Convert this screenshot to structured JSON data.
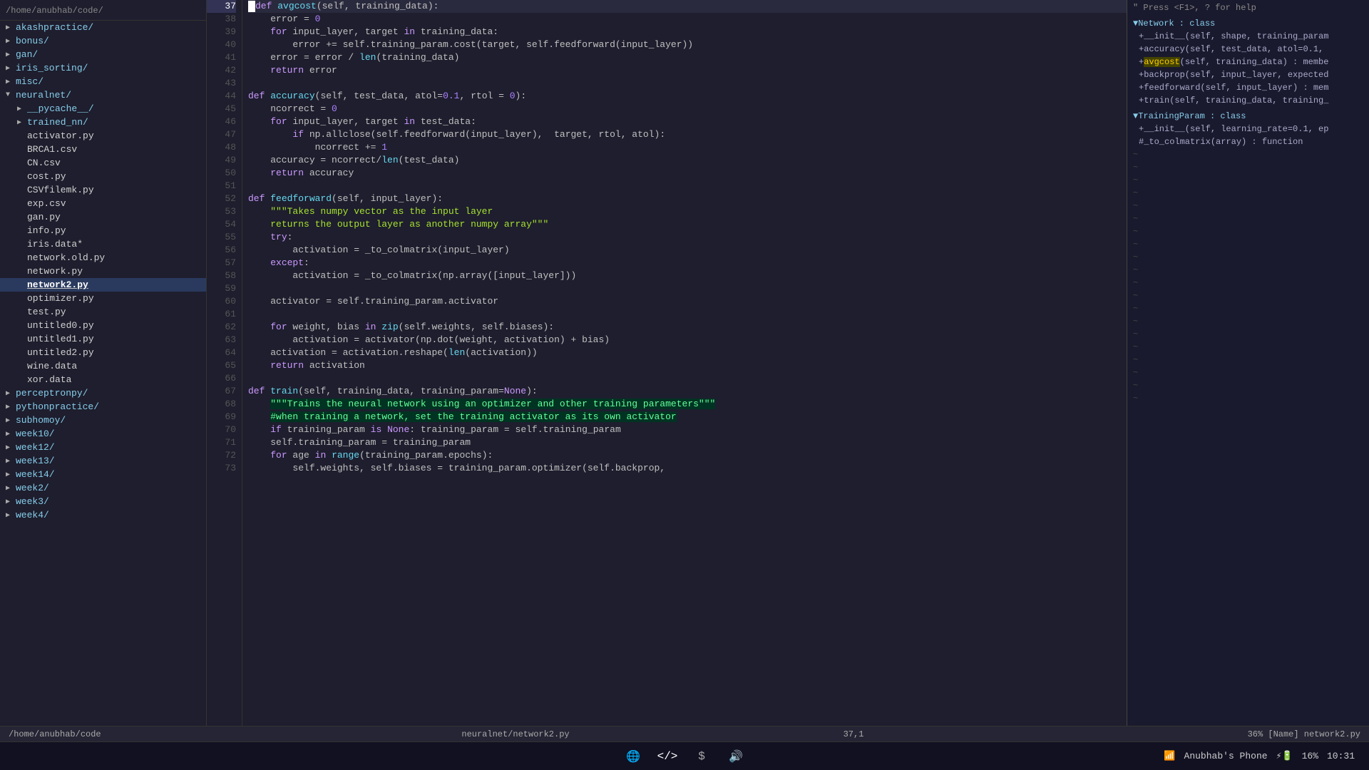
{
  "sidebar": {
    "root_path": "/home/anubhab/code/",
    "items": [
      {
        "id": "akashpractice",
        "label": "akashpractice/",
        "indent": 0,
        "type": "dir",
        "arrow": "▶",
        "expanded": false
      },
      {
        "id": "bonus",
        "label": "bonus/",
        "indent": 0,
        "type": "dir",
        "arrow": "▶",
        "expanded": false
      },
      {
        "id": "gan",
        "label": "gan/",
        "indent": 0,
        "type": "dir",
        "arrow": "▶",
        "expanded": false
      },
      {
        "id": "iris_sorting",
        "label": "iris_sorting/",
        "indent": 0,
        "type": "dir",
        "arrow": "▶",
        "expanded": false
      },
      {
        "id": "misc",
        "label": "misc/",
        "indent": 0,
        "type": "dir",
        "arrow": "▶",
        "expanded": false
      },
      {
        "id": "neuralnet",
        "label": "neuralnet/",
        "indent": 0,
        "type": "dir",
        "arrow": "▼",
        "expanded": true
      },
      {
        "id": "pycache",
        "label": "__pycache__/",
        "indent": 1,
        "type": "dir",
        "arrow": "▶",
        "expanded": false
      },
      {
        "id": "trained_nn",
        "label": "trained_nn/",
        "indent": 1,
        "type": "dir",
        "arrow": "▶",
        "expanded": false
      },
      {
        "id": "activator",
        "label": "activator.py",
        "indent": 1,
        "type": "file",
        "arrow": ""
      },
      {
        "id": "brca1",
        "label": "BRCA1.csv",
        "indent": 1,
        "type": "file",
        "arrow": ""
      },
      {
        "id": "cn",
        "label": "CN.csv",
        "indent": 1,
        "type": "file",
        "arrow": ""
      },
      {
        "id": "cost",
        "label": "cost.py",
        "indent": 1,
        "type": "file",
        "arrow": ""
      },
      {
        "id": "csvfilemk",
        "label": "CSVfilemk.py",
        "indent": 1,
        "type": "file",
        "arrow": ""
      },
      {
        "id": "exp",
        "label": "exp.csv",
        "indent": 1,
        "type": "file",
        "arrow": ""
      },
      {
        "id": "gan_py",
        "label": "gan.py",
        "indent": 1,
        "type": "file",
        "arrow": ""
      },
      {
        "id": "info",
        "label": "info.py",
        "indent": 1,
        "type": "file",
        "arrow": ""
      },
      {
        "id": "iris",
        "label": "iris.data*",
        "indent": 1,
        "type": "file",
        "arrow": ""
      },
      {
        "id": "network_old",
        "label": "network.old.py",
        "indent": 1,
        "type": "file",
        "arrow": ""
      },
      {
        "id": "network",
        "label": "network.py",
        "indent": 1,
        "type": "file",
        "arrow": ""
      },
      {
        "id": "network2",
        "label": "network2.py",
        "indent": 1,
        "type": "file",
        "arrow": "",
        "selected": true
      },
      {
        "id": "optimizer",
        "label": "optimizer.py",
        "indent": 1,
        "type": "file",
        "arrow": ""
      },
      {
        "id": "test",
        "label": "test.py",
        "indent": 1,
        "type": "file",
        "arrow": ""
      },
      {
        "id": "untitled0",
        "label": "untitled0.py",
        "indent": 1,
        "type": "file",
        "arrow": ""
      },
      {
        "id": "untitled1",
        "label": "untitled1.py",
        "indent": 1,
        "type": "file",
        "arrow": ""
      },
      {
        "id": "untitled2",
        "label": "untitled2.py",
        "indent": 1,
        "type": "file",
        "arrow": ""
      },
      {
        "id": "wine",
        "label": "wine.data",
        "indent": 1,
        "type": "file",
        "arrow": ""
      },
      {
        "id": "xor",
        "label": "xor.data",
        "indent": 1,
        "type": "file",
        "arrow": ""
      },
      {
        "id": "perceptronpy",
        "label": "perceptronpy/",
        "indent": 0,
        "type": "dir",
        "arrow": "▶",
        "expanded": false
      },
      {
        "id": "pythonpractice",
        "label": "pythonpractice/",
        "indent": 0,
        "type": "dir",
        "arrow": "▶",
        "expanded": false
      },
      {
        "id": "subhomoy",
        "label": "subhomoy/",
        "indent": 0,
        "type": "dir",
        "arrow": "▶",
        "expanded": false
      },
      {
        "id": "week10",
        "label": "week10/",
        "indent": 0,
        "type": "dir",
        "arrow": "▶",
        "expanded": false
      },
      {
        "id": "week12",
        "label": "week12/",
        "indent": 0,
        "type": "dir",
        "arrow": "▶",
        "expanded": false
      },
      {
        "id": "week13",
        "label": "week13/",
        "indent": 0,
        "type": "dir",
        "arrow": "▶",
        "expanded": false
      },
      {
        "id": "week14",
        "label": "week14/",
        "indent": 0,
        "type": "dir",
        "arrow": "▶",
        "expanded": false
      },
      {
        "id": "week2",
        "label": "week2/",
        "indent": 0,
        "type": "dir",
        "arrow": "▶",
        "expanded": false
      },
      {
        "id": "week3",
        "label": "week3/",
        "indent": 0,
        "type": "dir",
        "arrow": "▶",
        "expanded": false
      },
      {
        "id": "week4",
        "label": "week4/",
        "indent": 0,
        "type": "dir",
        "arrow": "▶",
        "expanded": false
      }
    ]
  },
  "editor": {
    "lines": [
      {
        "num": 37,
        "current": true,
        "text_html": "<span class='kw'>def</span> <span class='fn'>avgcost</span>(self, training_data):"
      },
      {
        "num": 38,
        "text_html": "    error = <span class='num'>0</span>"
      },
      {
        "num": 39,
        "text_html": "    <span class='kw'>for</span> input_layer, target <span class='kw'>in</span> training_data:"
      },
      {
        "num": 40,
        "text_html": "        error += self.training_param.cost(target, self.feedforward(input_layer))"
      },
      {
        "num": 41,
        "text_html": "    error = error / <span class='fn'>len</span>(training_data)"
      },
      {
        "num": 42,
        "text_html": "    <span class='kw'>return</span> error"
      },
      {
        "num": 43,
        "text_html": ""
      },
      {
        "num": 44,
        "text_html": "<span class='kw'>def</span> <span class='fn'>accuracy</span>(self, test_data, atol=<span class='num'>0.1</span>, rtol = <span class='num'>0</span>):"
      },
      {
        "num": 45,
        "text_html": "    ncorrect = <span class='num'>0</span>"
      },
      {
        "num": 46,
        "text_html": "    <span class='kw'>for</span> input_layer, target <span class='kw'>in</span> test_data:"
      },
      {
        "num": 47,
        "text_html": "        <span class='kw'>if</span> np.allclose(self.feedforward(input_layer),  target, rtol, atol):"
      },
      {
        "num": 48,
        "text_html": "            ncorrect += <span class='num'>1</span>"
      },
      {
        "num": 49,
        "text_html": "    accuracy = ncorrect/<span class='fn'>len</span>(test_data)"
      },
      {
        "num": 50,
        "text_html": "    <span class='kw'>return</span> accuracy"
      },
      {
        "num": 51,
        "text_html": ""
      },
      {
        "num": 52,
        "text_html": "<span class='kw'>def</span> <span class='fn'>feedforward</span>(self, input_layer):"
      },
      {
        "num": 53,
        "text_html": "    <span class='st'>\"\"\"Takes numpy vector as the input layer</span>"
      },
      {
        "num": 54,
        "text_html": "    <span class='st'>returns the output layer as another numpy array\"\"\"</span>"
      },
      {
        "num": 55,
        "text_html": "    <span class='kw'>try</span>:"
      },
      {
        "num": 56,
        "text_html": "        activation = _to_colmatrix(input_layer)"
      },
      {
        "num": 57,
        "text_html": "    <span class='kw'>except</span>:"
      },
      {
        "num": 58,
        "text_html": "        activation = _to_colmatrix(np.array([input_layer]))"
      },
      {
        "num": 59,
        "text_html": ""
      },
      {
        "num": 60,
        "text_html": "    activator = self.training_param.activator"
      },
      {
        "num": 61,
        "text_html": ""
      },
      {
        "num": 62,
        "text_html": "    <span class='kw'>for</span> weight, bias <span class='kw'>in</span> <span class='fn'>zip</span>(self.weights, self.biases):"
      },
      {
        "num": 63,
        "text_html": "        activation = activator(np.dot(weight, activation) + bias)"
      },
      {
        "num": 64,
        "text_html": "    activation = activation.reshape(<span class='fn'>len</span>(activation))"
      },
      {
        "num": 65,
        "text_html": "    <span class='kw'>return</span> activation"
      },
      {
        "num": 66,
        "text_html": ""
      },
      {
        "num": 67,
        "text_html": "<span class='kw'>def</span> <span class='fn'>train</span>(self, training_data, training_param=<span class='kw'>None</span>):"
      },
      {
        "num": 68,
        "text_html": "    <span class='hl-line'>\"\"\"Trains the neural network using an optimizer and other training parameters\"\"\"</span>"
      },
      {
        "num": 69,
        "text_html": "    <span class='hl-line'>#when training a network, set the training activator as its own activator</span>"
      },
      {
        "num": 70,
        "text_html": "    <span class='kw'>if</span> training_param <span class='kw'>is</span> <span class='kw'>None</span>: training_param = self.training_param"
      },
      {
        "num": 71,
        "text_html": "    self.training_param = training_param"
      },
      {
        "num": 72,
        "text_html": "    <span class='kw'>for</span> age <span class='kw'>in</span> <span class='fn'>range</span>(training_param.epochs):"
      },
      {
        "num": 73,
        "text_html": "        self.weights, self.biases = training_param.optimizer(self.backprop,"
      }
    ]
  },
  "right_panel": {
    "help_text": "\" Press <F1>, ? for help",
    "sections": [
      {
        "type": "section",
        "label": "▼Network : class",
        "items": [
          "+__init__(self, shape, training_param",
          "+accuracy(self, test_data, atol=0.1,",
          "+avgcost(self, training_data) : membe",
          "+backprop(self, input_layer, expected",
          "+feedforward(self, input_layer) : mem",
          "+train(self, training_data, training_"
        ],
        "highlight_item": 2
      },
      {
        "type": "section",
        "label": "▼TrainingParam : class",
        "items": [
          "+__init__(self, learning_rate=0.1, ep"
        ]
      },
      {
        "type": "item",
        "label": "#_to_colmatrix(array) : function"
      }
    ],
    "tildes": 20
  },
  "status_bar": {
    "path": "/home/anubhab/code",
    "file": "neuralnet/network2.py",
    "position": "37,1",
    "info": "36%  [Name]  network2.py"
  },
  "taskbar": {
    "icons": [
      "🌐",
      "</>",
      "$",
      "🔊"
    ],
    "wifi": "WiFi",
    "battery": "16%",
    "time": "10:31",
    "device": "Anubhab's Phone"
  }
}
